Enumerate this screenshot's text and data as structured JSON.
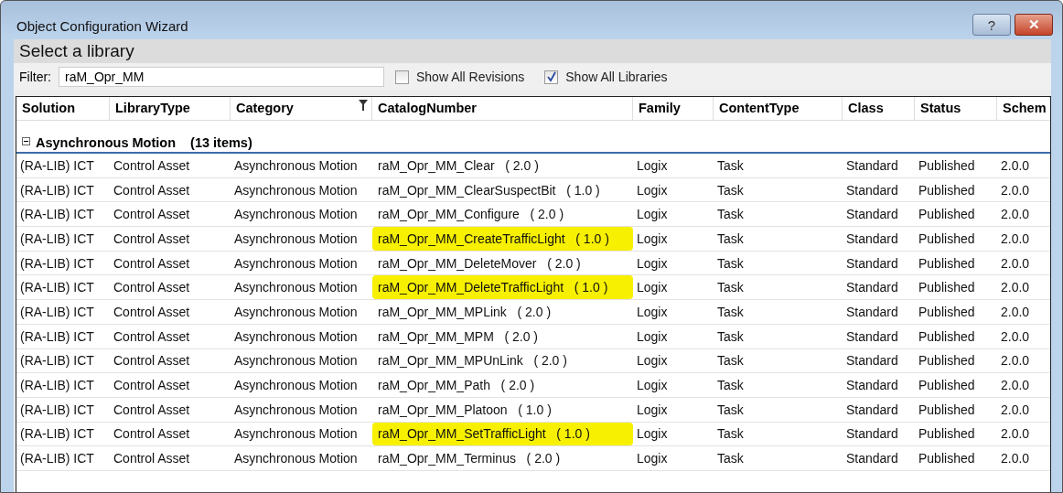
{
  "window": {
    "title": "Object Configuration Wizard",
    "buttons": [
      "?",
      "✕"
    ]
  },
  "heading": "Select a library",
  "filter": {
    "label": "Filter:",
    "value": "raM_Opr_MM"
  },
  "options": [
    {
      "label": "Show All Revisions",
      "checked": false
    },
    {
      "label": "Show All Libraries",
      "checked": true
    }
  ],
  "table": {
    "columns": [
      {
        "label": "Solution",
        "filtered": false
      },
      {
        "label": "LibraryType",
        "filtered": false
      },
      {
        "label": "Category",
        "filtered": true
      },
      {
        "label": "CatalogNumber",
        "filtered": false
      },
      {
        "label": "Family",
        "filtered": false
      },
      {
        "label": "ContentType",
        "filtered": false
      },
      {
        "label": "Class",
        "filtered": false
      },
      {
        "label": "Status",
        "filtered": false
      },
      {
        "label": "Schem",
        "filtered": false
      }
    ],
    "group": {
      "label": "Asynchronous Motion",
      "count": "(13 items)",
      "expanded": true
    },
    "rows": [
      {
        "cells": [
          "(RA-LIB) ICT",
          "Control Asset",
          "Asynchronous Motion",
          "raM_Opr_MM_Clear   ( 2.0 )",
          "Logix",
          "Task",
          "Standard",
          "Published",
          "2.0.0"
        ],
        "highlighted": false
      },
      {
        "cells": [
          "(RA-LIB) ICT",
          "Control Asset",
          "Asynchronous Motion",
          "raM_Opr_MM_ClearSuspectBit   ( 1.0 )",
          "Logix",
          "Task",
          "Standard",
          "Published",
          "2.0.0"
        ],
        "highlighted": false
      },
      {
        "cells": [
          "(RA-LIB) ICT",
          "Control Asset",
          "Asynchronous Motion",
          "raM_Opr_MM_Configure   ( 2.0 )",
          "Logix",
          "Task",
          "Standard",
          "Published",
          "2.0.0"
        ],
        "highlighted": false
      },
      {
        "cells": [
          "(RA-LIB) ICT",
          "Control Asset",
          "Asynchronous Motion",
          "raM_Opr_MM_CreateTrafficLight   ( 1.0 )",
          "Logix",
          "Task",
          "Standard",
          "Published",
          "2.0.0"
        ],
        "highlighted": true
      },
      {
        "cells": [
          "(RA-LIB) ICT",
          "Control Asset",
          "Asynchronous Motion",
          "raM_Opr_MM_DeleteMover   ( 2.0 )",
          "Logix",
          "Task",
          "Standard",
          "Published",
          "2.0.0"
        ],
        "highlighted": false
      },
      {
        "cells": [
          "(RA-LIB) ICT",
          "Control Asset",
          "Asynchronous Motion",
          "raM_Opr_MM_DeleteTrafficLight   ( 1.0 )",
          "Logix",
          "Task",
          "Standard",
          "Published",
          "2.0.0"
        ],
        "highlighted": true
      },
      {
        "cells": [
          "(RA-LIB) ICT",
          "Control Asset",
          "Asynchronous Motion",
          "raM_Opr_MM_MPLink   ( 2.0 )",
          "Logix",
          "Task",
          "Standard",
          "Published",
          "2.0.0"
        ],
        "highlighted": false
      },
      {
        "cells": [
          "(RA-LIB) ICT",
          "Control Asset",
          "Asynchronous Motion",
          "raM_Opr_MM_MPM   ( 2.0 )",
          "Logix",
          "Task",
          "Standard",
          "Published",
          "2.0.0"
        ],
        "highlighted": false
      },
      {
        "cells": [
          "(RA-LIB) ICT",
          "Control Asset",
          "Asynchronous Motion",
          "raM_Opr_MM_MPUnLink   ( 2.0 )",
          "Logix",
          "Task",
          "Standard",
          "Published",
          "2.0.0"
        ],
        "highlighted": false
      },
      {
        "cells": [
          "(RA-LIB) ICT",
          "Control Asset",
          "Asynchronous Motion",
          "raM_Opr_MM_Path   ( 2.0 )",
          "Logix",
          "Task",
          "Standard",
          "Published",
          "2.0.0"
        ],
        "highlighted": false
      },
      {
        "cells": [
          "(RA-LIB) ICT",
          "Control Asset",
          "Asynchronous Motion",
          "raM_Opr_MM_Platoon   ( 1.0 )",
          "Logix",
          "Task",
          "Standard",
          "Published",
          "2.0.0"
        ],
        "highlighted": false
      },
      {
        "cells": [
          "(RA-LIB) ICT",
          "Control Asset",
          "Asynchronous Motion",
          "raM_Opr_MM_SetTrafficLight   ( 1.0 )",
          "Logix",
          "Task",
          "Standard",
          "Published",
          "2.0.0"
        ],
        "highlighted": true
      },
      {
        "cells": [
          "(RA-LIB) ICT",
          "Control Asset",
          "Asynchronous Motion",
          "raM_Opr_MM_Terminus   ( 2.0 )",
          "Logix",
          "Task",
          "Standard",
          "Published",
          "2.0.0"
        ],
        "highlighted": false
      }
    ]
  }
}
